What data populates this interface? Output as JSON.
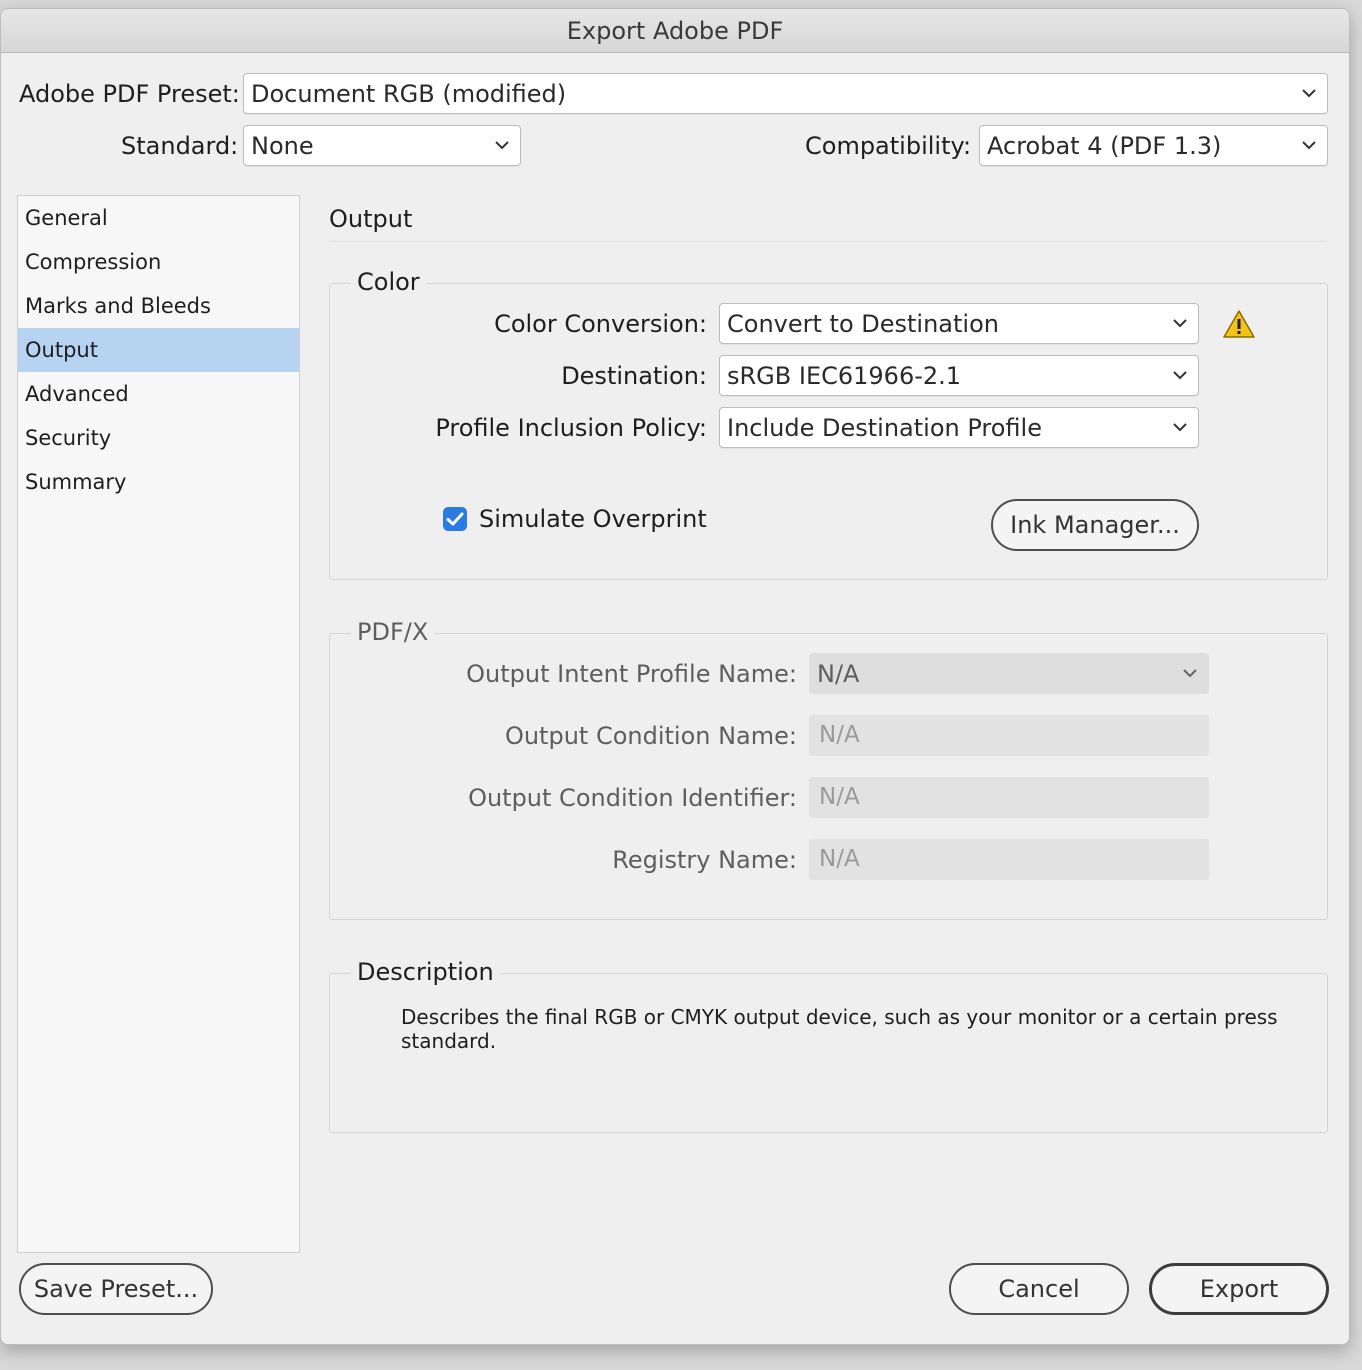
{
  "window": {
    "title": "Export Adobe PDF"
  },
  "header": {
    "preset_label": "Adobe PDF Preset:",
    "preset_value": "Document RGB (modified)",
    "standard_label": "Standard:",
    "standard_value": "None",
    "compat_label": "Compatibility:",
    "compat_value": "Acrobat 4 (PDF 1.3)"
  },
  "sidebar": {
    "items": [
      {
        "label": "General"
      },
      {
        "label": "Compression"
      },
      {
        "label": "Marks and Bleeds"
      },
      {
        "label": "Output"
      },
      {
        "label": "Advanced"
      },
      {
        "label": "Security"
      },
      {
        "label": "Summary"
      }
    ],
    "selected": "Output"
  },
  "panel": {
    "title": "Output"
  },
  "color": {
    "title": "Color",
    "conversion_label": "Color Conversion:",
    "conversion_value": "Convert to Destination",
    "destination_label": "Destination:",
    "destination_value": "sRGB IEC61966-2.1",
    "policy_label": "Profile Inclusion Policy:",
    "policy_value": "Include Destination Profile",
    "simulate_label": "Simulate Overprint",
    "simulate_checked": true,
    "ink_button": "Ink Manager...",
    "warning_icon": "warning-icon",
    "warning_color": "#f2c318"
  },
  "pdfx": {
    "title": "PDF/X",
    "intent_label": "Output Intent Profile Name:",
    "intent_value": "N/A",
    "condition_name_label": "Output Condition Name:",
    "condition_name_value": "N/A",
    "condition_id_label": "Output Condition Identifier:",
    "condition_id_value": "N/A",
    "registry_label": "Registry Name:",
    "registry_value": "N/A"
  },
  "description": {
    "title": "Description",
    "text": "Describes the final RGB or CMYK output device, such as your monitor or a certain press standard."
  },
  "footer": {
    "save_preset": "Save Preset...",
    "cancel": "Cancel",
    "export": "Export"
  },
  "colors": {
    "selection": "#b7d3f2",
    "checkbox": "#2c7be5"
  }
}
